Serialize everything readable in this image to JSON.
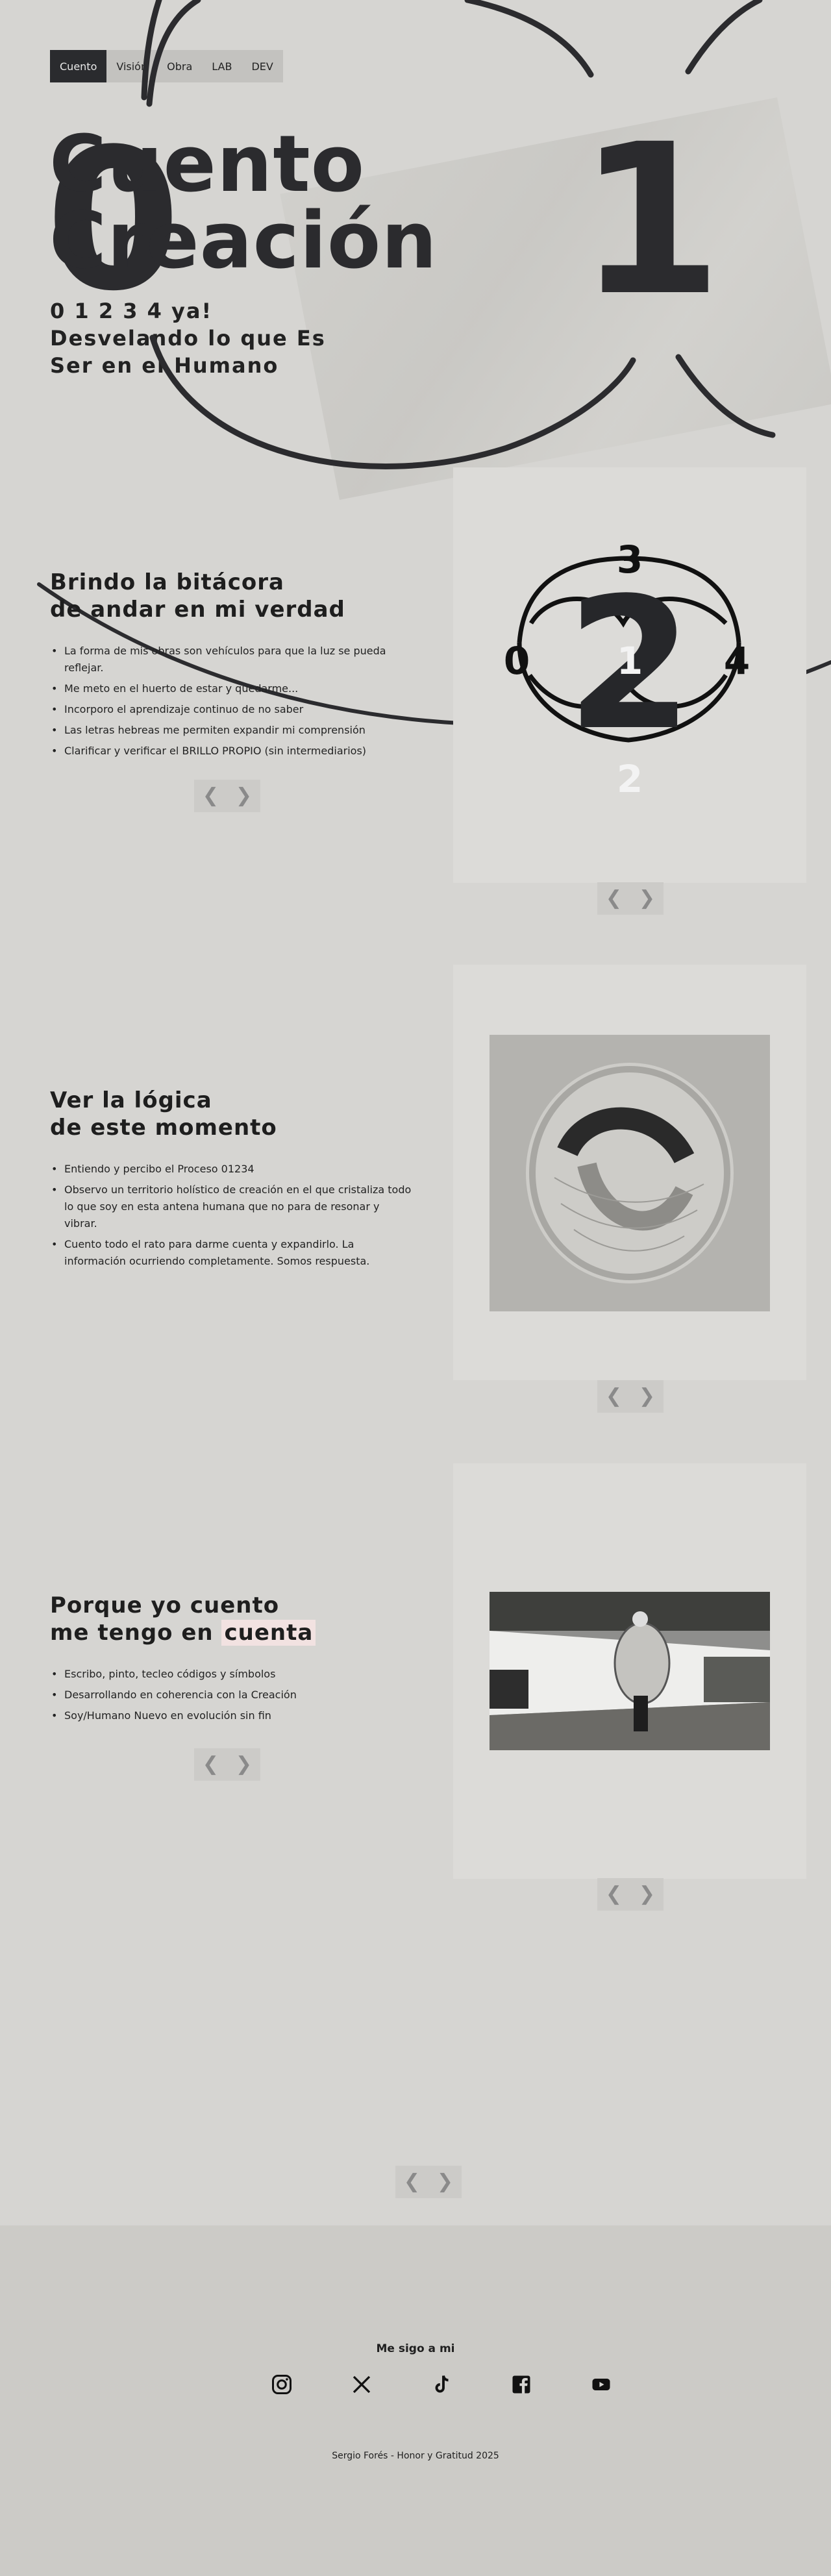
{
  "nav": {
    "items": [
      {
        "label": "Cuento",
        "active": true
      },
      {
        "label": "Visión",
        "active": false
      },
      {
        "label": "Obra",
        "active": false
      },
      {
        "label": "LAB",
        "active": false
      },
      {
        "label": "DEV",
        "active": false
      }
    ]
  },
  "hero": {
    "big_left": "0",
    "big_right": "1",
    "title_line1": "Cuento",
    "title_line2": "Creación",
    "sub_line1": "0 1 2 3 4 ya!",
    "sub_line2": "Desvelando lo que Es",
    "sub_line3": "Ser en el Humano"
  },
  "sections": [
    {
      "title_line1": "Brindo la bitácora",
      "title_line2": "de andar en mi verdad",
      "bullets": [
        "La forma de mis obras son vehículos para que la luz se pueda reflejar.",
        "Me meto en el huerto de estar y quedarme...",
        "Incorporo el aprendizaje continuo de no saber",
        "Las letras hebreas me permiten expandir mi comprensión",
        "Clarificar y verificar el BRILLO PROPIO (sin intermediarios)"
      ],
      "diagram_numbers": [
        "3",
        "0",
        "1",
        "4",
        "2",
        "2"
      ]
    },
    {
      "title_line1": "Ver la lógica",
      "title_line2": "de este momento",
      "bullets": [
        "Entiendo y percibo el Proceso 01234",
        "Observo un territorio holístico de creación en el que cristaliza todo lo que soy en esta antena humana que no para de resonar y vibrar.",
        "Cuento todo el rato para darme cuenta y expandirlo. La información ocurriendo completamente. Somos respuesta."
      ]
    },
    {
      "title_line1": "Porque yo cuento",
      "title_line2_pre": "me tengo en ",
      "title_line2_hl": "cuenta",
      "bullets": [
        "Escribo, pinto, tecleo códigos y símbolos",
        "Desarrollando en coherencia con la Creación",
        "Soy/Humano Nuevo en evolución sin fin"
      ]
    }
  ],
  "arrows": {
    "prev": "❮",
    "next": "❯"
  },
  "footer": {
    "follow_label": "Me sigo a mi",
    "socials": [
      "instagram-icon",
      "x-icon",
      "tiktok-icon",
      "facebook-icon",
      "youtube-icon"
    ],
    "copyright": "Sergio Forés - Honor y Gratitud 2025"
  }
}
